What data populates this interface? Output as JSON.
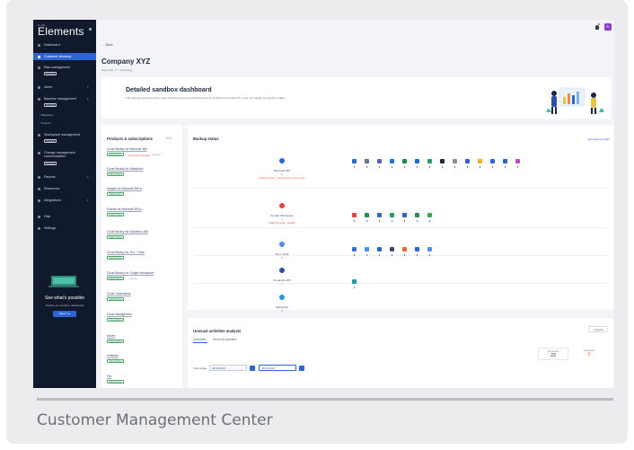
{
  "caption": "Customer Management Center",
  "sidebar": {
    "brand_small": "N-able",
    "brand": "Elements",
    "items": [
      {
        "label": "Dashboard"
      },
      {
        "label": "Customer directory"
      },
      {
        "label": "Risk management",
        "pill": "Preview"
      },
      {
        "label": "Alerts"
      },
      {
        "label": "Baseline management",
        "pill": "Preview",
        "subs": [
          "Baselines",
          "Tenants"
        ]
      },
      {
        "label": "Workspace management",
        "pill": "Preview"
      },
      {
        "label": "Change management communication",
        "pill": "Preview"
      },
      {
        "label": "Reports"
      },
      {
        "label": "Resources"
      },
      {
        "label": "Integrations"
      },
      {
        "label": "Help"
      },
      {
        "label": "Settings"
      }
    ],
    "promo": {
      "title": "See what's possible",
      "subtitle": "Explore our sandbox dashboard",
      "button": "Show me"
    }
  },
  "header": {
    "avatar": "PL",
    "back": "← Back",
    "company": "Company XYZ",
    "crumbs": "Regionally · IT · Technology"
  },
  "banner": {
    "title": "Detailed sandbox dashboard",
    "text": "This sample customer tenant view shows how you can track and resolve incidents that matter the most. Act rapidly as insights surface."
  },
  "products": {
    "title": "Products & subscriptions",
    "count": "10 ▾",
    "items": [
      {
        "name": "Cloud Backup for Microsoft 365",
        "tag": "Subscription",
        "warn": "Trial (30 remaining)",
        "muted": "Upgrade"
      },
      {
        "name": "Cloud Backup for Salesforce",
        "tag": "Subscription"
      },
      {
        "name": "Insights for Microsoft 365 ⧉",
        "tag": "Subscription"
      },
      {
        "name": "Policies for Microsoft 365 ⧉",
        "tag": "Subscription"
      },
      {
        "name": "Cloud Backup for Dynamics 365",
        "tag": "Subscription"
      },
      {
        "name": "Cloud Backup for Jira + Trello",
        "tag": "Subscription"
      },
      {
        "name": "Cloud Backup for Google Workspace",
        "tag": "Subscription",
        "muted": "Upgrade"
      },
      {
        "name": "Cloud Governance",
        "tag": "Subscription"
      },
      {
        "name": "Cloud Management",
        "tag": "Subscription"
      },
      {
        "name": "Server",
        "tag": "Subscription"
      },
      {
        "name": "Software",
        "tag": "Subscription"
      },
      {
        "name": "File",
        "tag": "Subscription"
      }
    ]
  },
  "backup": {
    "title": "Backup status",
    "link": "View backup details",
    "systems": [
      {
        "name": "Microsoft 365",
        "warn": "Failing tenants · Last backup 2 hours ago",
        "color": "#2a66d6"
      },
      {
        "name": "Google Workspace",
        "warn": "Failing tenants · Details",
        "color": "#e2443b"
      },
      {
        "name": "Jira + Trello",
        "warn": "",
        "color": "#4f8bf0"
      },
      {
        "name": "Dynamics 365",
        "warn": "",
        "color": "#2d4fa8"
      },
      {
        "name": "Salesforce",
        "warn": "",
        "color": "#1f9ad6"
      }
    ]
  },
  "activities": {
    "title": "Unusual activities analysis",
    "export": "Export",
    "tabs": [
      "Overview",
      "Show all activities"
    ],
    "stats": [
      {
        "label": "Processed",
        "value": "23"
      },
      {
        "label": "Suspicious",
        "value": "0"
      }
    ],
    "range_label": "Time range",
    "date_from": "03/15/2023",
    "date_to": "03/16/2023"
  },
  "colors": {
    "sidebar": "#111a2c",
    "accent": "#2a66d6",
    "success": "#2f8a50",
    "danger": "#d9534f"
  }
}
